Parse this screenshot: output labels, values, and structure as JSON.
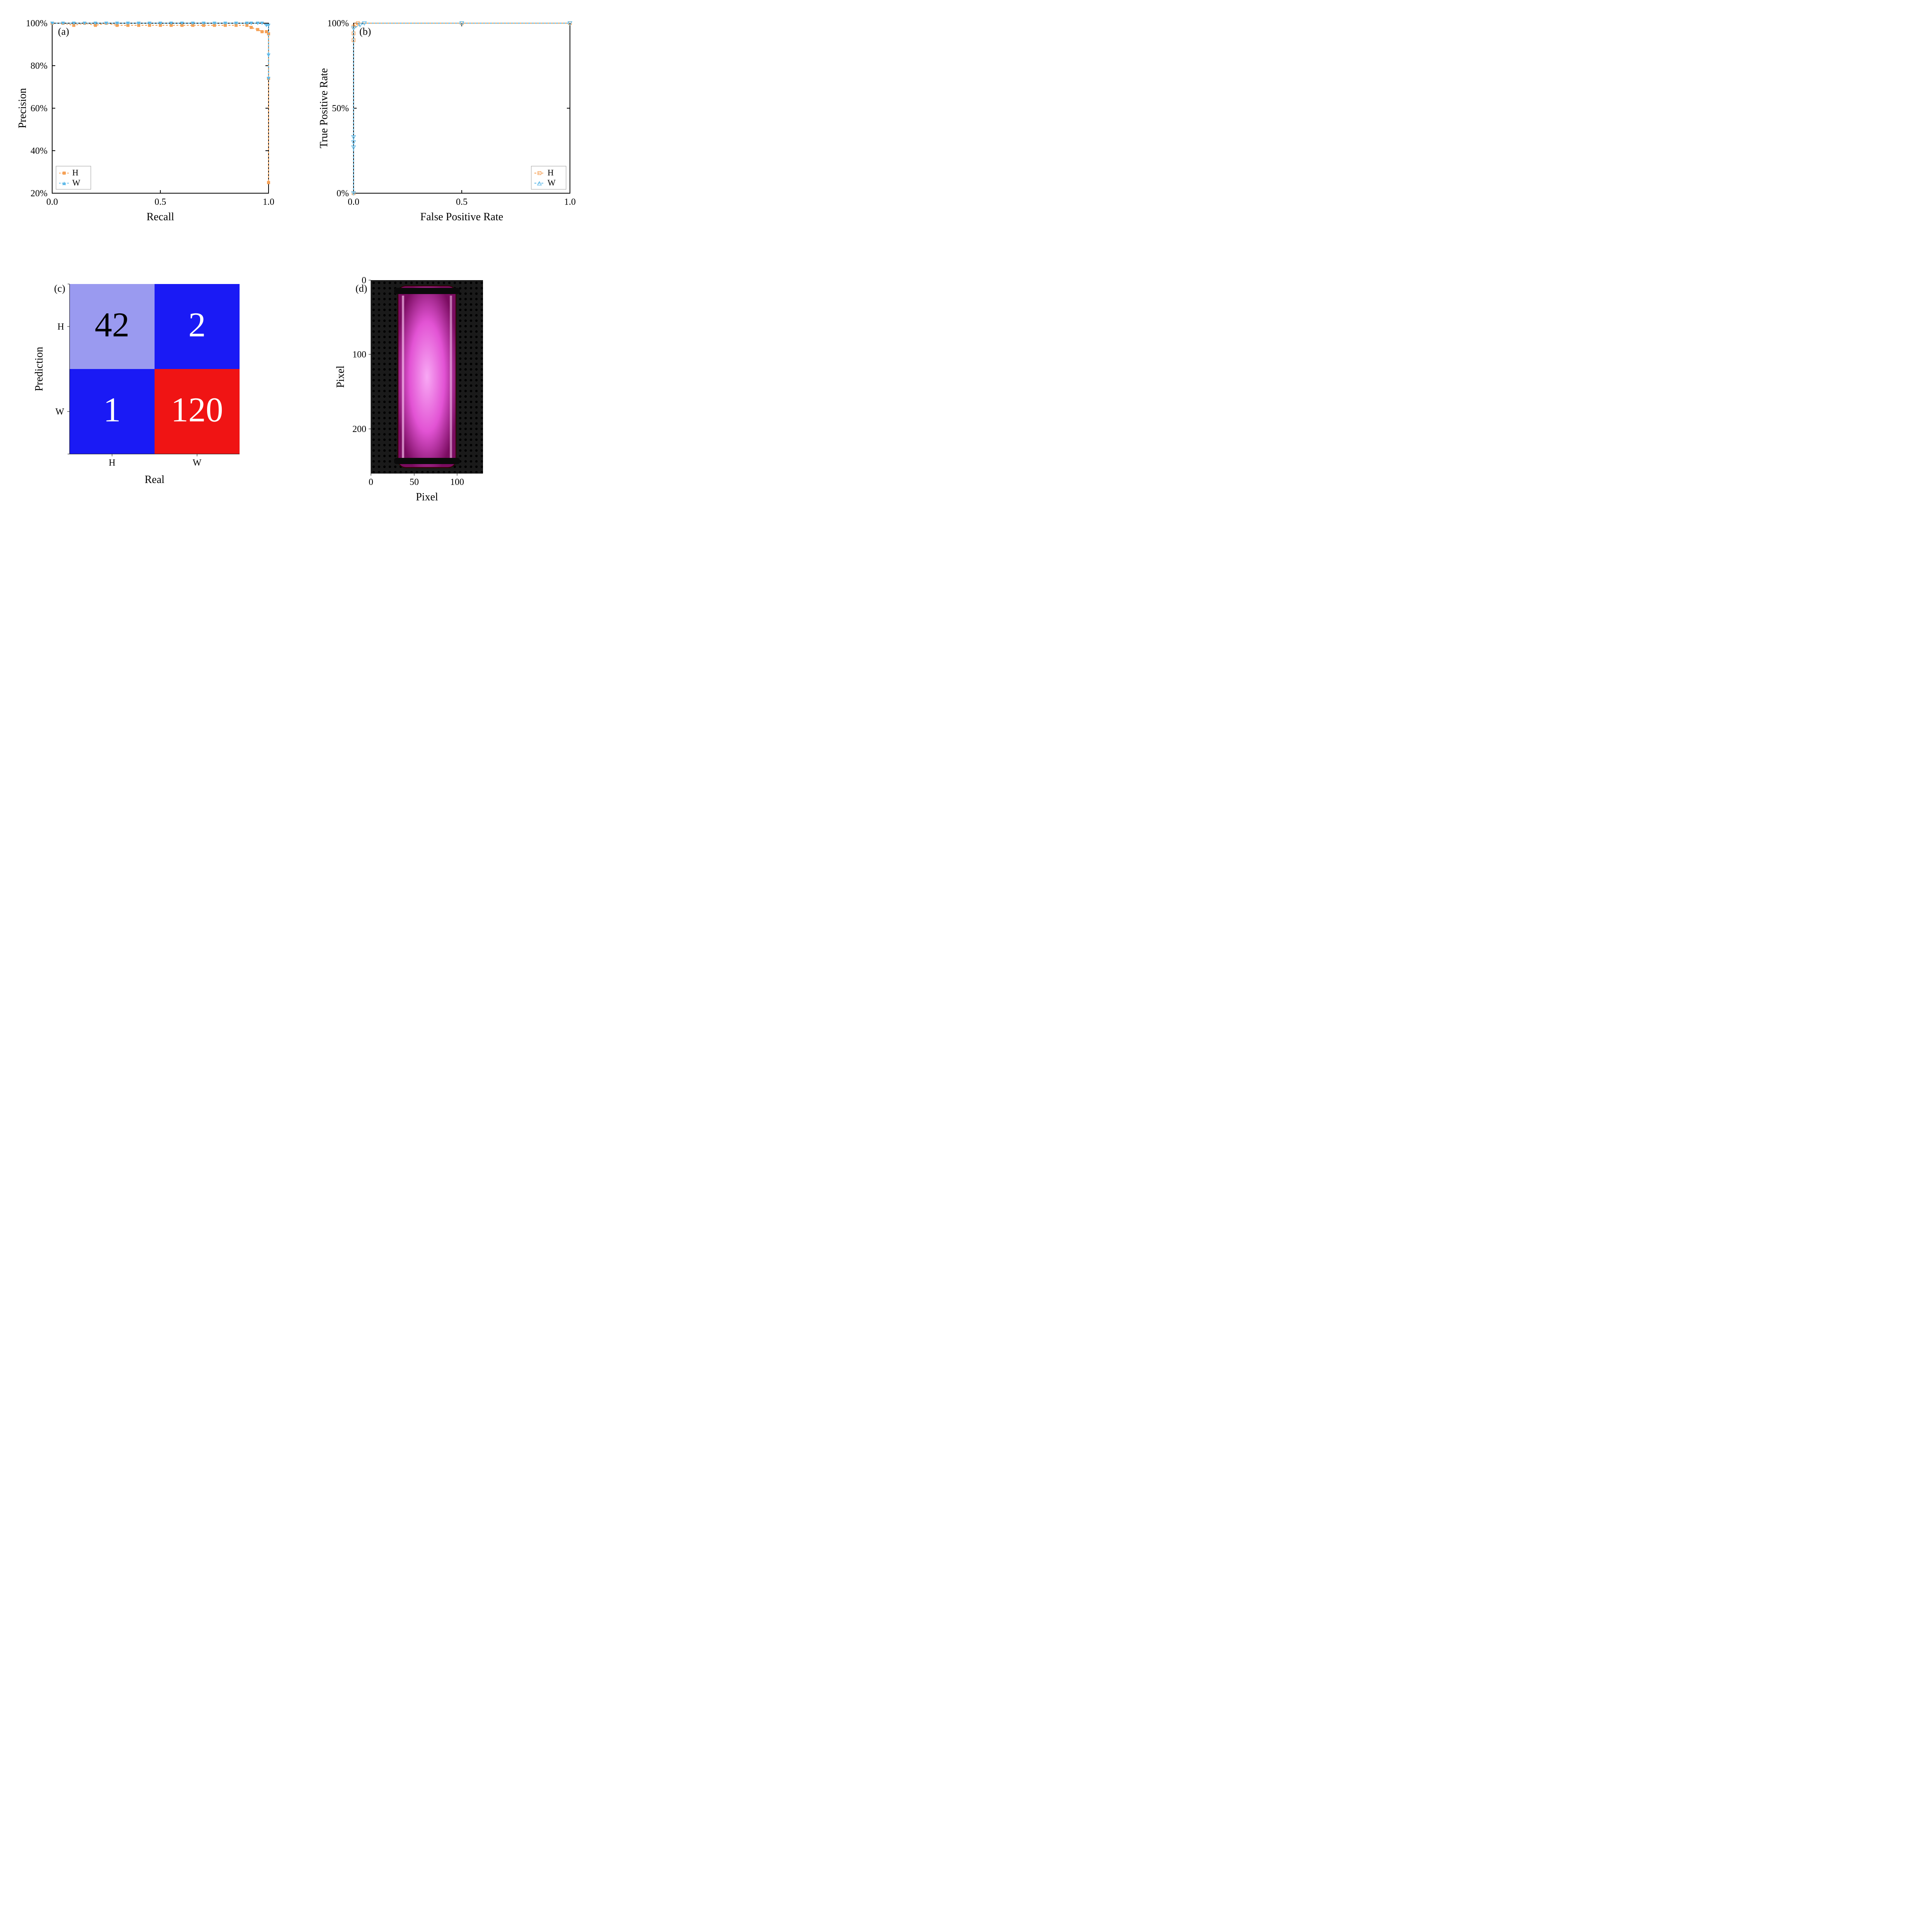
{
  "colors": {
    "orange": "#F5A157",
    "blue": "#5FB9E8",
    "cm_low": "#9A9AF0",
    "cm_mid": "#1A1AF5",
    "cm_high": "#F01414"
  },
  "panel_a": {
    "tag": "(a)",
    "xlabel": "Recall",
    "ylabel": "Precision",
    "x_ticks": [
      0.0,
      0.5,
      1.0
    ],
    "y_ticks_pct": [
      20,
      40,
      60,
      80,
      100
    ],
    "legend": [
      "H",
      "W"
    ]
  },
  "panel_b": {
    "tag": "(b)",
    "xlabel": "False Positive Rate",
    "ylabel": "True Positive Rate",
    "x_ticks": [
      0.0,
      0.5,
      1.0
    ],
    "y_ticks_pct": [
      0,
      50,
      100
    ],
    "legend": [
      "H",
      "W"
    ]
  },
  "panel_c": {
    "tag": "(c)",
    "xlabel": "Real",
    "ylabel": "Prediction",
    "row_labels": [
      "H",
      "W"
    ],
    "col_labels": [
      "H",
      "W"
    ],
    "cells": [
      [
        42,
        2
      ],
      [
        1,
        120
      ]
    ]
  },
  "panel_d": {
    "tag": "(d)",
    "xlabel": "Pixel",
    "ylabel": "Pixel",
    "x_ticks": [
      0,
      50,
      100
    ],
    "y_ticks": [
      0,
      100,
      200
    ]
  },
  "chart_data": [
    {
      "type": "line",
      "panel": "a",
      "title": "(a) Precision–Recall",
      "xlabel": "Recall",
      "ylabel": "Precision",
      "xlim": [
        0.0,
        1.0
      ],
      "ylim": [
        20,
        100
      ],
      "y_unit": "%",
      "series": [
        {
          "name": "H",
          "marker": "square",
          "color": "#F5A157",
          "x": [
            0.0,
            0.05,
            0.1,
            0.15,
            0.2,
            0.25,
            0.3,
            0.35,
            0.4,
            0.45,
            0.5,
            0.55,
            0.6,
            0.65,
            0.7,
            0.75,
            0.8,
            0.85,
            0.9,
            0.92,
            0.95,
            0.97,
            0.99,
            1.0,
            1.0,
            1.0
          ],
          "y": [
            100,
            100,
            99,
            100,
            99,
            100,
            99,
            99,
            99,
            99,
            99,
            99,
            99,
            99,
            99,
            99,
            99,
            99,
            99,
            98,
            97,
            96,
            96,
            95,
            74,
            25
          ]
        },
        {
          "name": "W",
          "marker": "triangle-down",
          "color": "#5FB9E8",
          "x": [
            0.0,
            0.05,
            0.1,
            0.15,
            0.2,
            0.25,
            0.3,
            0.35,
            0.4,
            0.45,
            0.5,
            0.55,
            0.6,
            0.65,
            0.7,
            0.75,
            0.8,
            0.85,
            0.9,
            0.92,
            0.95,
            0.97,
            0.99,
            1.0,
            1.0,
            1.0
          ],
          "y": [
            100,
            100,
            100,
            100,
            100,
            100,
            100,
            100,
            100,
            100,
            100,
            100,
            100,
            100,
            100,
            100,
            100,
            100,
            100,
            100,
            100,
            100,
            99,
            99,
            85,
            74
          ]
        }
      ]
    },
    {
      "type": "line",
      "panel": "b",
      "title": "(b) ROC",
      "xlabel": "False Positive Rate",
      "ylabel": "True Positive Rate",
      "xlim": [
        0.0,
        1.0
      ],
      "ylim": [
        0,
        100
      ],
      "y_unit": "%",
      "series": [
        {
          "name": "H",
          "marker": "open-square",
          "color": "#F5A157",
          "x": [
            0.0,
            0.0,
            0.0,
            0.0,
            0.01,
            0.02,
            0.5,
            1.0
          ],
          "y": [
            0,
            90,
            94,
            98,
            99,
            100,
            100,
            100
          ]
        },
        {
          "name": "W",
          "marker": "open-triangle-down",
          "color": "#5FB9E8",
          "x": [
            0.0,
            0.0,
            0.0,
            0.0,
            0.0,
            0.03,
            0.05,
            0.5,
            1.0
          ],
          "y": [
            0,
            27,
            30,
            33,
            97,
            99,
            100,
            100,
            100
          ]
        }
      ]
    },
    {
      "type": "heatmap",
      "panel": "c",
      "title": "(c) Confusion Matrix",
      "xlabel": "Real",
      "ylabel": "Prediction",
      "x_categories": [
        "H",
        "W"
      ],
      "y_categories": [
        "H",
        "W"
      ],
      "values": [
        [
          42,
          2
        ],
        [
          1,
          120
        ]
      ]
    },
    {
      "type": "table",
      "panel": "d",
      "title": "(d) Sample image",
      "xlabel": "Pixel",
      "ylabel": "Pixel",
      "xlim": [
        0,
        130
      ],
      "ylim": [
        0,
        260
      ],
      "note": "Photograph of a magenta-glowing cylindrical discharge tube against a dark perforated background; axes show pixel coordinates."
    }
  ]
}
